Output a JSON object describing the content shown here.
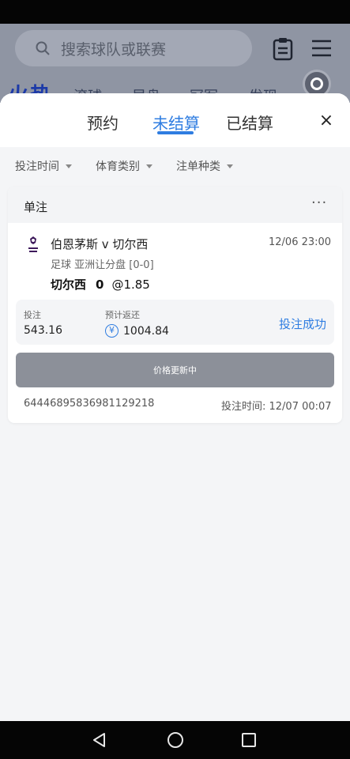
{
  "background": {
    "search_placeholder": "搜索球队或联赛",
    "logo_text": "火热",
    "nav_items": [
      "滚球",
      "早盘",
      "冠军",
      "发现"
    ]
  },
  "sheet": {
    "tabs": [
      "预约",
      "未结算",
      "已结算"
    ],
    "active_tab": "未结算",
    "close_label": "×"
  },
  "filters": [
    "投注时间",
    "体育类别",
    "注单种类"
  ],
  "bet_card": {
    "type_label": "单注",
    "more_label": "···",
    "match": "伯恩茅斯 v 切尔西",
    "match_time": "12/06 23:00",
    "market": "足球 亚洲让分盘 [0-0]",
    "selection": "切尔西",
    "line": "0",
    "odds": "@1.85",
    "stake_label": "投注",
    "stake_value": "543.16",
    "return_label": "预计返还",
    "return_value": "1004.84",
    "currency_symbol": "¥",
    "status": "投注成功",
    "price_button": "价格更新中",
    "bet_id": "64446895836981129218",
    "placed_time": "投注时间: 12/07 00:07"
  },
  "colors": {
    "accent": "#2f7de1",
    "button_gray": "#8c9099",
    "overlay": "#8f95a3"
  }
}
